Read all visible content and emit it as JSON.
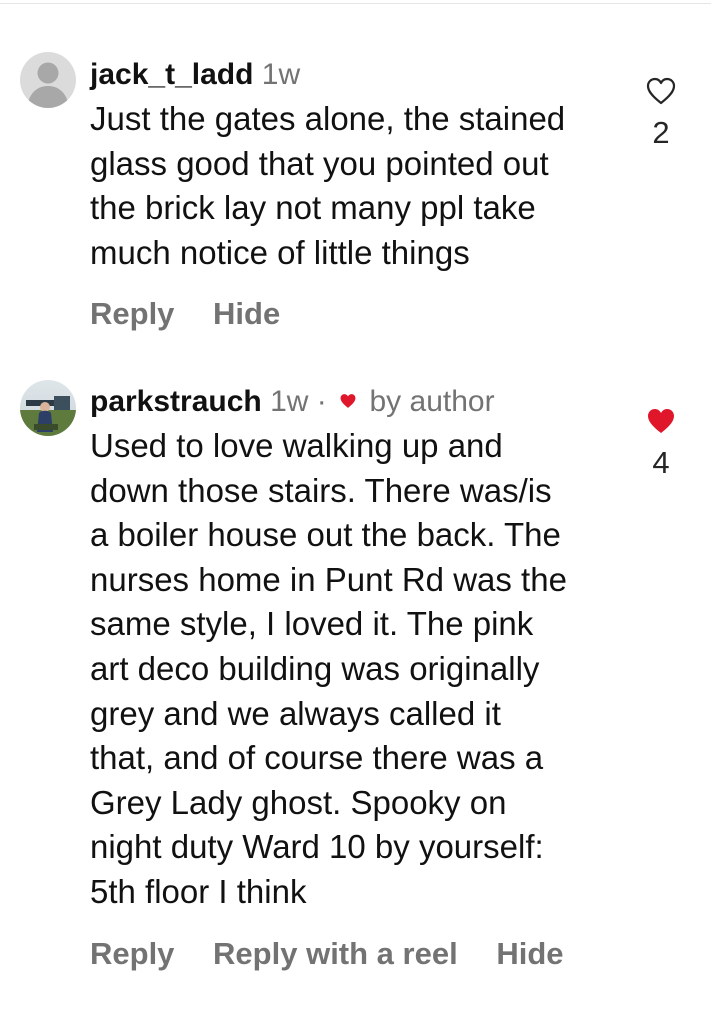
{
  "colors": {
    "secondary_text": "#737373",
    "primary_text": "#111111",
    "like_red": "#e0162b",
    "avatar_placeholder": "#c7c7c7"
  },
  "comments": [
    {
      "username": "jack_t_ladd",
      "time": "1w",
      "text": "Just the gates alone, the stained\nglass good that you pointed out\nthe brick lay not many ppl take\nmuch notice of little things",
      "actions": [
        "Reply",
        "Hide"
      ],
      "like_count": "2",
      "liked": false,
      "avatar": "default-avatar-icon"
    },
    {
      "username": "parkstrauch",
      "time": "1w",
      "separator": "·",
      "liked_by_author_label": "by author",
      "text": "Used to love walking up and\ndown those stairs. There was/is\na boiler house out the back. The\nnurses home in Punt Rd was the\nsame style, I loved it. The pink\nart deco building was originally\ngrey and we always called it\nthat, and of course there was a\nGrey Lady ghost. Spooky on\nnight duty Ward 10 by yourself:\n5th floor I think",
      "actions": [
        "Reply",
        "Reply with a reel",
        "Hide"
      ],
      "like_count": "4",
      "liked": true,
      "avatar": "photo-avatar"
    }
  ]
}
